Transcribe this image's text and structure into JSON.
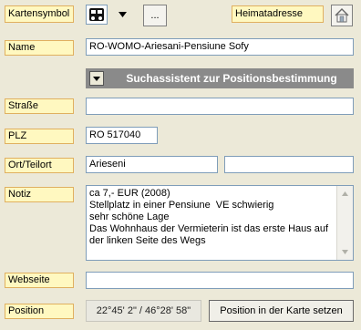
{
  "symbol": {
    "label": "Kartensymbol",
    "more_button": "..."
  },
  "home": {
    "label": "Heimatadresse"
  },
  "name": {
    "label": "Name",
    "value": "RO-WOMO-Ariesani-Pensiune Sofy"
  },
  "assistant": {
    "label": "Suchassistent zur Positionsbestimmung"
  },
  "street": {
    "label": "Straße",
    "value": ""
  },
  "zip": {
    "label": "PLZ",
    "value": "RO 517040"
  },
  "city": {
    "label": "Ort/Teilort",
    "value": "Arieseni",
    "value2": ""
  },
  "note": {
    "label": "Notiz",
    "value": "ca 7,- EUR (2008)\nStellplatz in einer Pensiune  VE schwierig\nsehr schöne Lage\nDas Wohnhaus der Vermieterin ist das erste Haus auf der linken Seite des Wegs"
  },
  "website": {
    "label": "Webseite",
    "value": ""
  },
  "position": {
    "label": "Position",
    "value": "22°45' 2\" / 46°28' 58\"",
    "set_button": "Position in der Karte setzen"
  },
  "icons": {
    "symbol": "campervan-symbol-icon",
    "dropdown": "chevron-down-icon",
    "home": "home-icon",
    "scroll_up": "scroll-up-icon",
    "scroll_down": "scroll-down-icon"
  },
  "colors": {
    "label_bg": "#fff8c0",
    "label_border": "#e0b060",
    "assistant_bg": "#8a8a8a"
  }
}
